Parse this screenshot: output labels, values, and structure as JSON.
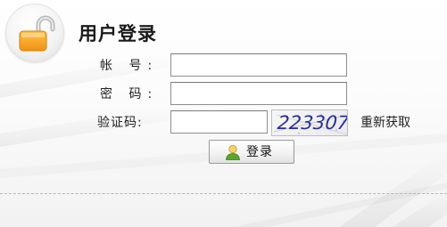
{
  "header": {
    "title": "用户登录"
  },
  "form": {
    "account_label": "帐 号:",
    "password_label": "密 码:",
    "captcha_label": "验证码:",
    "account_value": "",
    "password_value": "",
    "captcha_value": "",
    "captcha_code": "223307",
    "refresh_label": "重新获取",
    "login_label": "登录"
  },
  "icons": {
    "lock": "lock-open-icon",
    "user": "user-icon"
  },
  "colors": {
    "lock_body": "#f5a623",
    "captcha_text": "#2b2f8e",
    "user_icon": "#5aa52c"
  }
}
